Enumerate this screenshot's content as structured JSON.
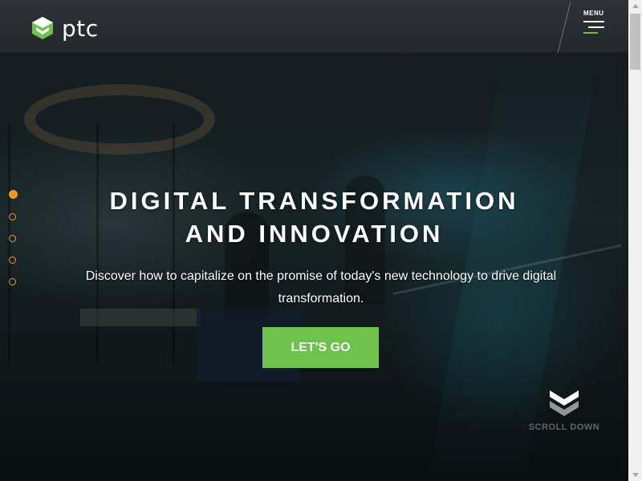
{
  "header": {
    "brand": "ptc",
    "menu_label": "MENU"
  },
  "hero": {
    "headline_line1": "DIGITAL TRANSFORMATION",
    "headline_line2": "AND INNOVATION",
    "subtext": "Discover how to capitalize on the promise of today's new technology to drive digital transformation.",
    "cta_label": "LET'S GO",
    "scroll_label": "SCROLL DOWN",
    "slide_count": 5,
    "active_slide": 1
  },
  "colors": {
    "accent_green": "#6cc24a",
    "accent_orange": "#f7941d",
    "header_bg": "#2e3236"
  },
  "icons": {
    "logo": "ptc-logo-icon",
    "menu": "hamburger-menu-icon",
    "scroll": "chevron-double-down-icon"
  }
}
